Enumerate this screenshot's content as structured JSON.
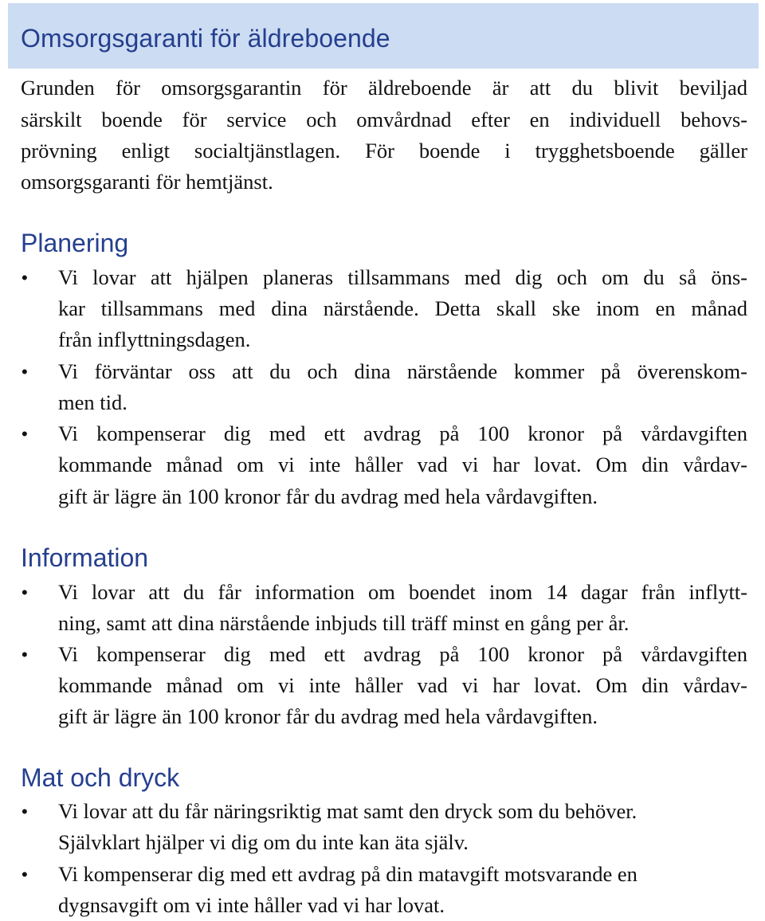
{
  "header": {
    "title": "Omsorgsgaranti för äldreboende",
    "band_color": "#ccdcf2",
    "heading_color": "#253f8f"
  },
  "intro": {
    "lines": [
      "Grunden för omsorgsgarantin för äldreboende är att du blivit beviljad",
      "särskilt boende för service och omvårdnad efter en individuell behovs-",
      "prövning enligt socialtjänstlagen. För boende i trygghetsboende gäller",
      "omsorgsgaranti för hemtjänst."
    ]
  },
  "sections": [
    {
      "heading": "Planering",
      "bullets": [
        {
          "lines": [
            "Vi lovar att hjälpen planeras tillsammans med dig och om du så öns-",
            "kar tillsammans med dina närstående. Detta skall ske inom en månad",
            "från inflyttningsdagen."
          ]
        },
        {
          "lines": [
            "Vi förväntar oss att du och dina närstående kommer på överenskom-",
            "men tid."
          ]
        },
        {
          "lines": [
            "Vi kompenserar dig med ett avdrag på 100 kronor på vårdavgiften",
            "kommande månad om vi inte håller vad vi har lovat. Om din vårdav-",
            "gift är lägre än 100 kronor får du avdrag med hela vårdavgiften."
          ]
        }
      ]
    },
    {
      "heading": "Information",
      "bullets": [
        {
          "lines": [
            "Vi lovar att du får information om boendet inom 14 dagar från inflytt-",
            "ning, samt att dina närstående inbjuds till träff minst en gång per år."
          ]
        },
        {
          "lines": [
            "Vi kompenserar dig med ett avdrag på 100 kronor på vårdavgiften",
            "kommande månad om vi inte håller vad vi har lovat. Om din vårdav-",
            "gift är lägre än 100 kronor får du avdrag med hela vårdavgiften."
          ]
        }
      ]
    },
    {
      "heading": "Mat och dryck",
      "bullets": [
        {
          "lines": [
            "Vi lovar att du får näringsriktig mat samt den dryck som du behöver.",
            "Självklart hjälper vi dig om du inte kan äta själv."
          ]
        },
        {
          "lines": [
            "Vi kompenserar dig med ett avdrag på din matavgift motsvarande en",
            "dygnsavgift om vi inte håller vad vi har lovat."
          ]
        }
      ]
    }
  ],
  "bullet_glyph": "•"
}
